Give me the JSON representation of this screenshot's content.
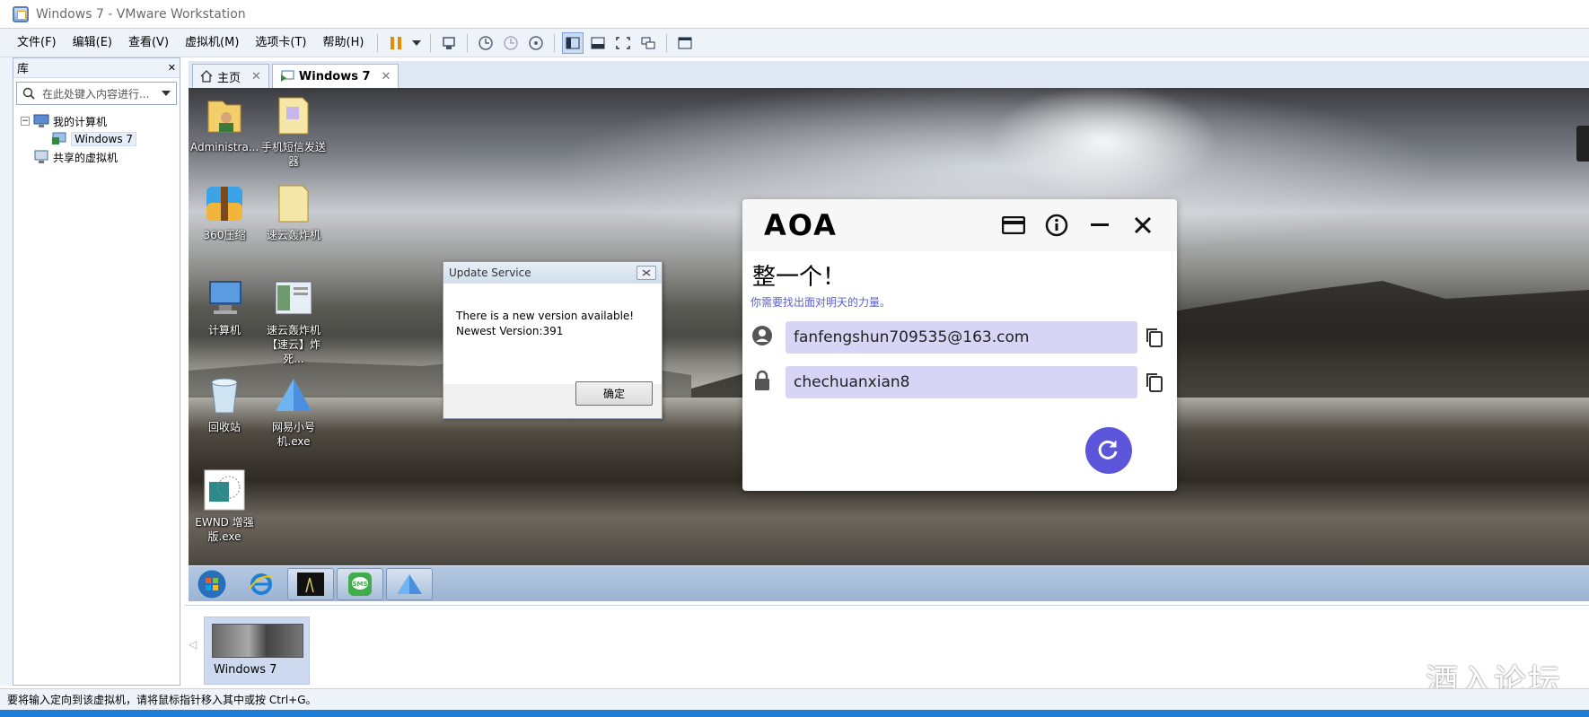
{
  "window": {
    "title": "Windows 7 - VMware Workstation"
  },
  "menu": [
    "文件(F)",
    "编辑(E)",
    "查看(V)",
    "虚拟机(M)",
    "选项卡(T)",
    "帮助(H)"
  ],
  "library": {
    "title": "库",
    "close": "✕",
    "search_placeholder": "在此处键入内容进行...",
    "tree": {
      "my_computer": "我的计算机",
      "vm": "Windows 7",
      "shared": "共享的虚拟机"
    }
  },
  "tabs": [
    {
      "label": "主页",
      "close": "✕"
    },
    {
      "label": "Windows 7",
      "close": "✕"
    }
  ],
  "desktop_icons": [
    {
      "label": "Administra..."
    },
    {
      "label": "手机短信发送器"
    },
    {
      "label": "360压缩"
    },
    {
      "label": "速云轰炸机"
    },
    {
      "label": "计算机"
    },
    {
      "label": "速云轰炸机【速云】炸死..."
    },
    {
      "label": "回收站"
    },
    {
      "label": "网易小号机.exe"
    },
    {
      "label": "EWND 增强版.exe"
    }
  ],
  "update_dialog": {
    "title": "Update Service",
    "line1": "There is a new version available!",
    "line2": "Newest Version:391",
    "ok": "确定"
  },
  "aoa": {
    "logo": "AOA",
    "heading": "整一个！",
    "subtitle": "你需要找出面对明天的力量。",
    "email": "fanfengshun709535@163.com",
    "password": "chechuanxian8"
  },
  "thumbnail": {
    "label": "Windows 7"
  },
  "status": "要将输入定向到该虚拟机，请将鼠标指针移入其中或按 Ctrl+G。",
  "watermark": "酒入论坛",
  "colors": {
    "accent": "#5a55d9",
    "field": "#d6d5f6",
    "statusbar_blue": "#1f7fd8"
  }
}
